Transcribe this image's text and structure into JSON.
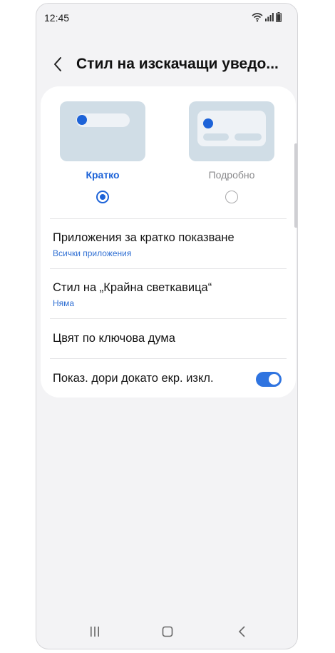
{
  "status_bar": {
    "time": "12:45"
  },
  "header": {
    "title": "Стил на изскачащи уведо..."
  },
  "style_options": [
    {
      "label": "Кратко",
      "selected": true
    },
    {
      "label": "Подробно",
      "selected": false
    }
  ],
  "settings": [
    {
      "title": "Приложения за кратко показване",
      "subtitle": "Всички приложения"
    },
    {
      "title": "Стил на „Крайна светкавица“",
      "subtitle": "Няма"
    },
    {
      "title": "Цвят по ключова дума"
    },
    {
      "title": "Показ. дори докато екр. изкл.",
      "toggle_on": true
    }
  ],
  "colors": {
    "accent": "#1d63d8",
    "background": "#f3f3f5",
    "preview": "#d0dde6"
  },
  "icons": {
    "back": "chevron-left-icon",
    "wifi": "wifi-icon",
    "signal": "signal-icon",
    "battery": "battery-icon"
  }
}
